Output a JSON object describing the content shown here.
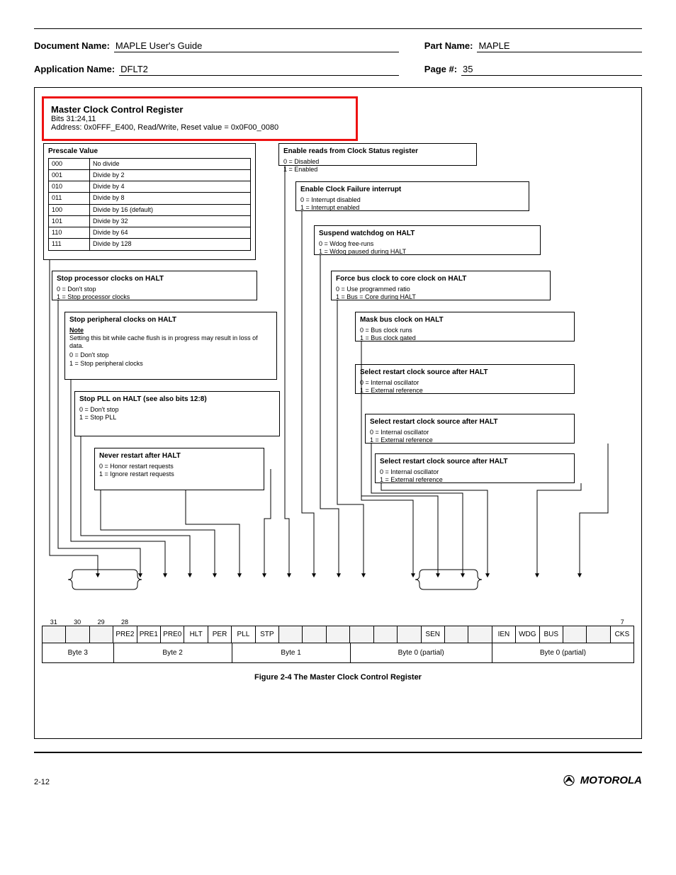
{
  "header": {
    "doc_label": "Document Name:",
    "doc_value": "MAPLE User's Guide",
    "part_label": "Part Name:",
    "part_value": "MAPLE",
    "app_label": "Application Name:",
    "app_value": "DFLT2",
    "page_label": "Page #:",
    "page_value": "35"
  },
  "red": {
    "title": "Master Clock Control Register",
    "bitsline": "Bits 31:24,11",
    "addrline": "Address: 0x0FFF_E400, Read/Write, Reset value = 0x0F00_0080"
  },
  "prescale": {
    "title": "Prescale Value",
    "rows": [
      [
        "000",
        "No divide"
      ],
      [
        "001",
        "Divide by 2"
      ],
      [
        "010",
        "Divide by 4"
      ],
      [
        "011",
        "Divide by 8"
      ],
      [
        "100",
        "Divide by 16 (default)"
      ],
      [
        "101",
        "Divide by 32"
      ],
      [
        "110",
        "Divide by 64"
      ],
      [
        "111",
        "Divide by 128"
      ]
    ]
  },
  "hlt": {
    "title": "Stop processor clocks on HALT",
    "v0": "0 = Don't stop",
    "v1": "1 = Stop processor clocks"
  },
  "peri": {
    "title": "Stop peripheral clocks on HALT",
    "note_label": "Note",
    "note_text": "Setting this bit while cache flush is in progress may result in loss of data.",
    "v0": "0 = Don't stop",
    "v1": "1 = Stop peripheral clocks"
  },
  "pll": {
    "title": "Stop PLL on HALT (see also bits 12:8)",
    "v0": "0 = Don't stop",
    "v1": "1 = Stop PLL"
  },
  "stop": {
    "title": "Never restart after HALT",
    "v0": "0 = Honor restart requests",
    "v1": "1 = Ignore restart requests"
  },
  "sysen": {
    "title": "Enable reads from Clock Status register",
    "v0": "0 = Disabled",
    "v1": "1 = Enabled"
  },
  "inten": {
    "title": "Enable Clock Failure interrupt",
    "v0": "0 = Interrupt disabled",
    "v1": "1 = Interrupt enabled"
  },
  "wdog": {
    "title": "Suspend watchdog on HALT",
    "v0": "0 = Wdog free-runs",
    "v1": "1 = Wdog paused during HALT"
  },
  "bus13": {
    "title": "Force bus clock to core clock on HALT",
    "v0": "0 = Use programmed ratio",
    "v1": "1 = Bus = Core during HALT"
  },
  "bus12": {
    "title": "Mask bus clock on HALT",
    "v0": "0 = Bus clock runs",
    "v1": "1 = Bus clock gated"
  },
  "cksrc": {
    "title": "Select restart clock source after HALT",
    "v0": "0 = Internal oscillator",
    "v1": "1 = External reference"
  },
  "bitnames": [
    "",
    "",
    "",
    "PRE2",
    "PRE1",
    "PRE0",
    "HLT",
    "PER",
    "PLL",
    "STP",
    "",
    "",
    "",
    "",
    "",
    "",
    "SEN",
    "",
    "",
    "IEN",
    "WDG",
    "BUS",
    "",
    "",
    "CKS"
  ],
  "bitindices_top": [
    "31",
    "30",
    "29",
    "28",
    "",
    "",
    "",
    "",
    "",
    "",
    "",
    "",
    "",
    "",
    "",
    "",
    "",
    "",
    "",
    "",
    "",
    "",
    "",
    "",
    "7"
  ],
  "bytes": [
    "Byte 3",
    "Byte 2",
    "Byte 1",
    "Byte 0 (partial)",
    "Byte 0 (partial)"
  ],
  "byte_flex": [
    3,
    5,
    5,
    6,
    6
  ],
  "figcaption": "Figure 2-4 The Master Clock Control Register",
  "footer": {
    "left": "2-12",
    "right": "MOTOROLA"
  }
}
